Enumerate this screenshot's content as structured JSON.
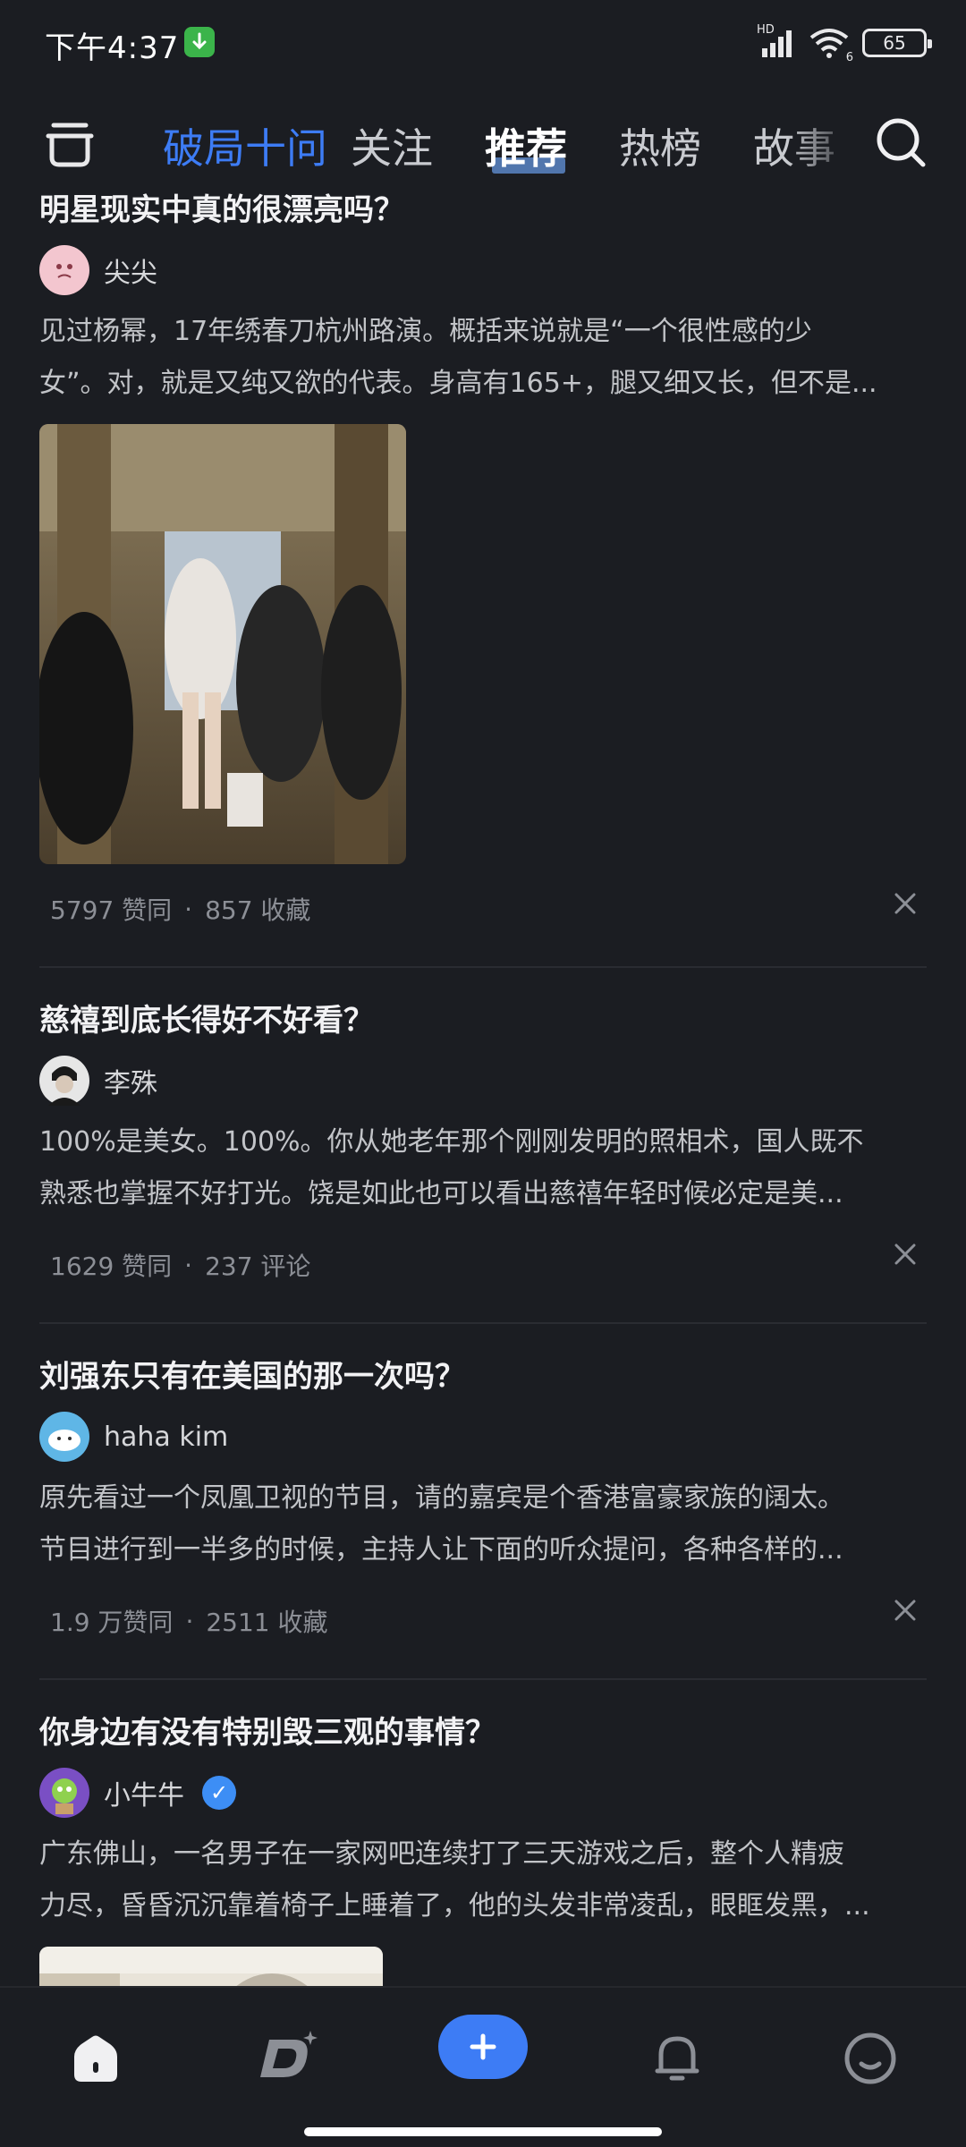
{
  "status_bar": {
    "time": "下午4:37",
    "network": "HD",
    "wifi_badge": "6",
    "battery": "65"
  },
  "nav": {
    "tabs": [
      {
        "label": "破局十问"
      },
      {
        "label": "关注"
      },
      {
        "label": "推荐"
      },
      {
        "label": "热榜"
      },
      {
        "label": "故事"
      }
    ],
    "selected_tab": "推荐"
  },
  "feed": [
    {
      "title": "明星现实中真的很漂亮吗？",
      "author": "尖尖",
      "excerpt_line1": "见过杨幂，17年绣春刀杭州路演。概括来说就是“一个很性感的少",
      "excerpt_line2": "女”。对，就是又纯又欲的代表。身高有165+，腿又细又长，但不是...",
      "stat1": "5797 赞同",
      "separator": "·",
      "stat2": "857 收藏"
    },
    {
      "title": "慈禧到底长得好不好看？",
      "author": "李殊",
      "excerpt_line1": "100%是美女。100%。你从她老年那个刚刚发明的照相术，国人既不",
      "excerpt_line2": "熟悉也掌握不好打光。饶是如此也可以看出慈禧年轻时候必定是美...",
      "stat1": "1629 赞同",
      "separator": "·",
      "stat2": "237 评论"
    },
    {
      "title": "刘强东只有在美国的那一次吗？",
      "author": "haha kim",
      "excerpt_line1": "原先看过一个凤凰卫视的节目，请的嘉宾是个香港富豪家族的阔太。",
      "excerpt_line2": "节目进行到一半多的时候，主持人让下面的听众提问，各种各样的...",
      "stat1": "1.9 万赞同",
      "separator": "·",
      "stat2": "2511 收藏"
    },
    {
      "title": "你身边有没有特别毁三观的事情？",
      "author": "小牛牛",
      "excerpt_line1": "广东佛山，一名男子在一家网吧连续打了三天游戏之后，整个人精疲",
      "excerpt_line2": "力尽，昏昏沉沉靠着椅子上睡着了，他的头发非常凌乱，眼眶发黑，..."
    }
  ],
  "bottom_nav": {
    "items": [
      "home-icon",
      "discover-icon",
      "add-icon",
      "notification-icon",
      "profile-icon"
    ]
  },
  "colors": {
    "background": "#1b1d22",
    "accent": "#3d7cf5",
    "muted": "#8c8f96"
  }
}
